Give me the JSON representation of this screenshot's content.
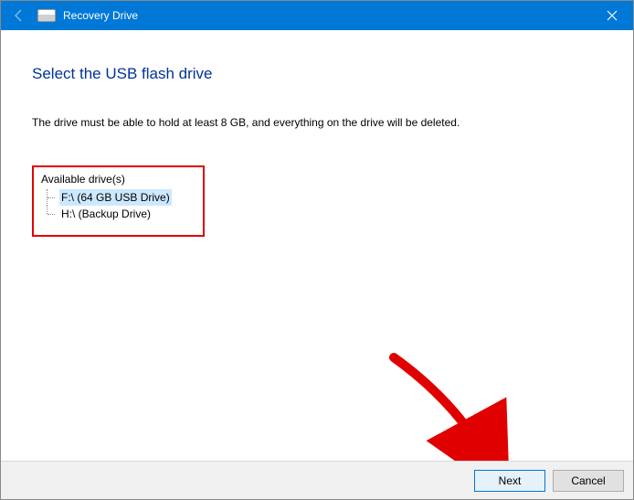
{
  "titlebar": {
    "title": "Recovery Drive"
  },
  "content": {
    "heading": "Select the USB flash drive",
    "instruction": "The drive must be able to hold at least 8 GB, and everything on the drive will be deleted.",
    "section_label": "Available drive(s)",
    "drives": [
      {
        "label": "F:\\ (64 GB USB Drive)",
        "selected": true
      },
      {
        "label": "H:\\ (Backup Drive)",
        "selected": false
      }
    ]
  },
  "footer": {
    "next_label": "Next",
    "cancel_label": "Cancel"
  }
}
